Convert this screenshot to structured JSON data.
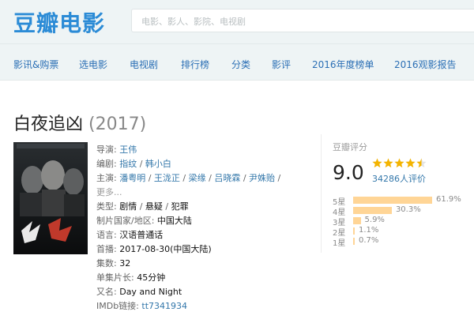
{
  "header": {
    "logo_text": "豆瓣电影",
    "search_placeholder": "电影、影人、影院、电视剧"
  },
  "nav": [
    {
      "label": "影讯&购票"
    },
    {
      "label": "选电影"
    },
    {
      "label": "电视剧"
    },
    {
      "label": "排行榜"
    },
    {
      "label": "分类"
    },
    {
      "label": "影评"
    },
    {
      "label": "2016年度榜单"
    },
    {
      "label": "2016观影报告"
    }
  ],
  "movie": {
    "title": "白夜追凶",
    "year": "(2017)"
  },
  "info": {
    "director_label": "导演:",
    "director": "王伟",
    "writer_label": "编剧:",
    "writers": [
      "指纹",
      "韩小白"
    ],
    "cast_label": "主演:",
    "cast": [
      "潘粤明",
      "王泷正",
      "梁缘",
      "吕晓霖",
      "尹姝贻"
    ],
    "more": "更多...",
    "genre_label": "类型:",
    "genres": [
      "剧情",
      "悬疑",
      "犯罪"
    ],
    "region_label": "制片国家/地区:",
    "region": "中国大陆",
    "language_label": "语言:",
    "language": "汉语普通话",
    "premiere_label": "首播:",
    "premiere": "2017-08-30(中国大陆)",
    "episodes_label": "集数:",
    "episodes": "32",
    "runtime_label": "单集片长:",
    "runtime": "45分钟",
    "aka_label": "又名:",
    "aka": "Day and Night",
    "imdb_label": "IMDb链接:",
    "imdb": "tt7341934",
    "slash": " / "
  },
  "rating": {
    "label": "豆瓣评分",
    "score": "9.0",
    "stars": 4.5,
    "votes": "34286人评价",
    "distribution": [
      {
        "label": "5星",
        "percent": 61.9,
        "text": "61.9%"
      },
      {
        "label": "4星",
        "percent": 30.3,
        "text": "30.3%"
      },
      {
        "label": "3星",
        "percent": 5.9,
        "text": "5.9%"
      },
      {
        "label": "2星",
        "percent": 1.1,
        "text": "1.1%"
      },
      {
        "label": "1星",
        "percent": 0.7,
        "text": "0.7%"
      }
    ]
  },
  "colors": {
    "brand": "#2b8bd6",
    "link": "#3377aa",
    "star": "#f4b400",
    "bar": "#ffd596"
  }
}
